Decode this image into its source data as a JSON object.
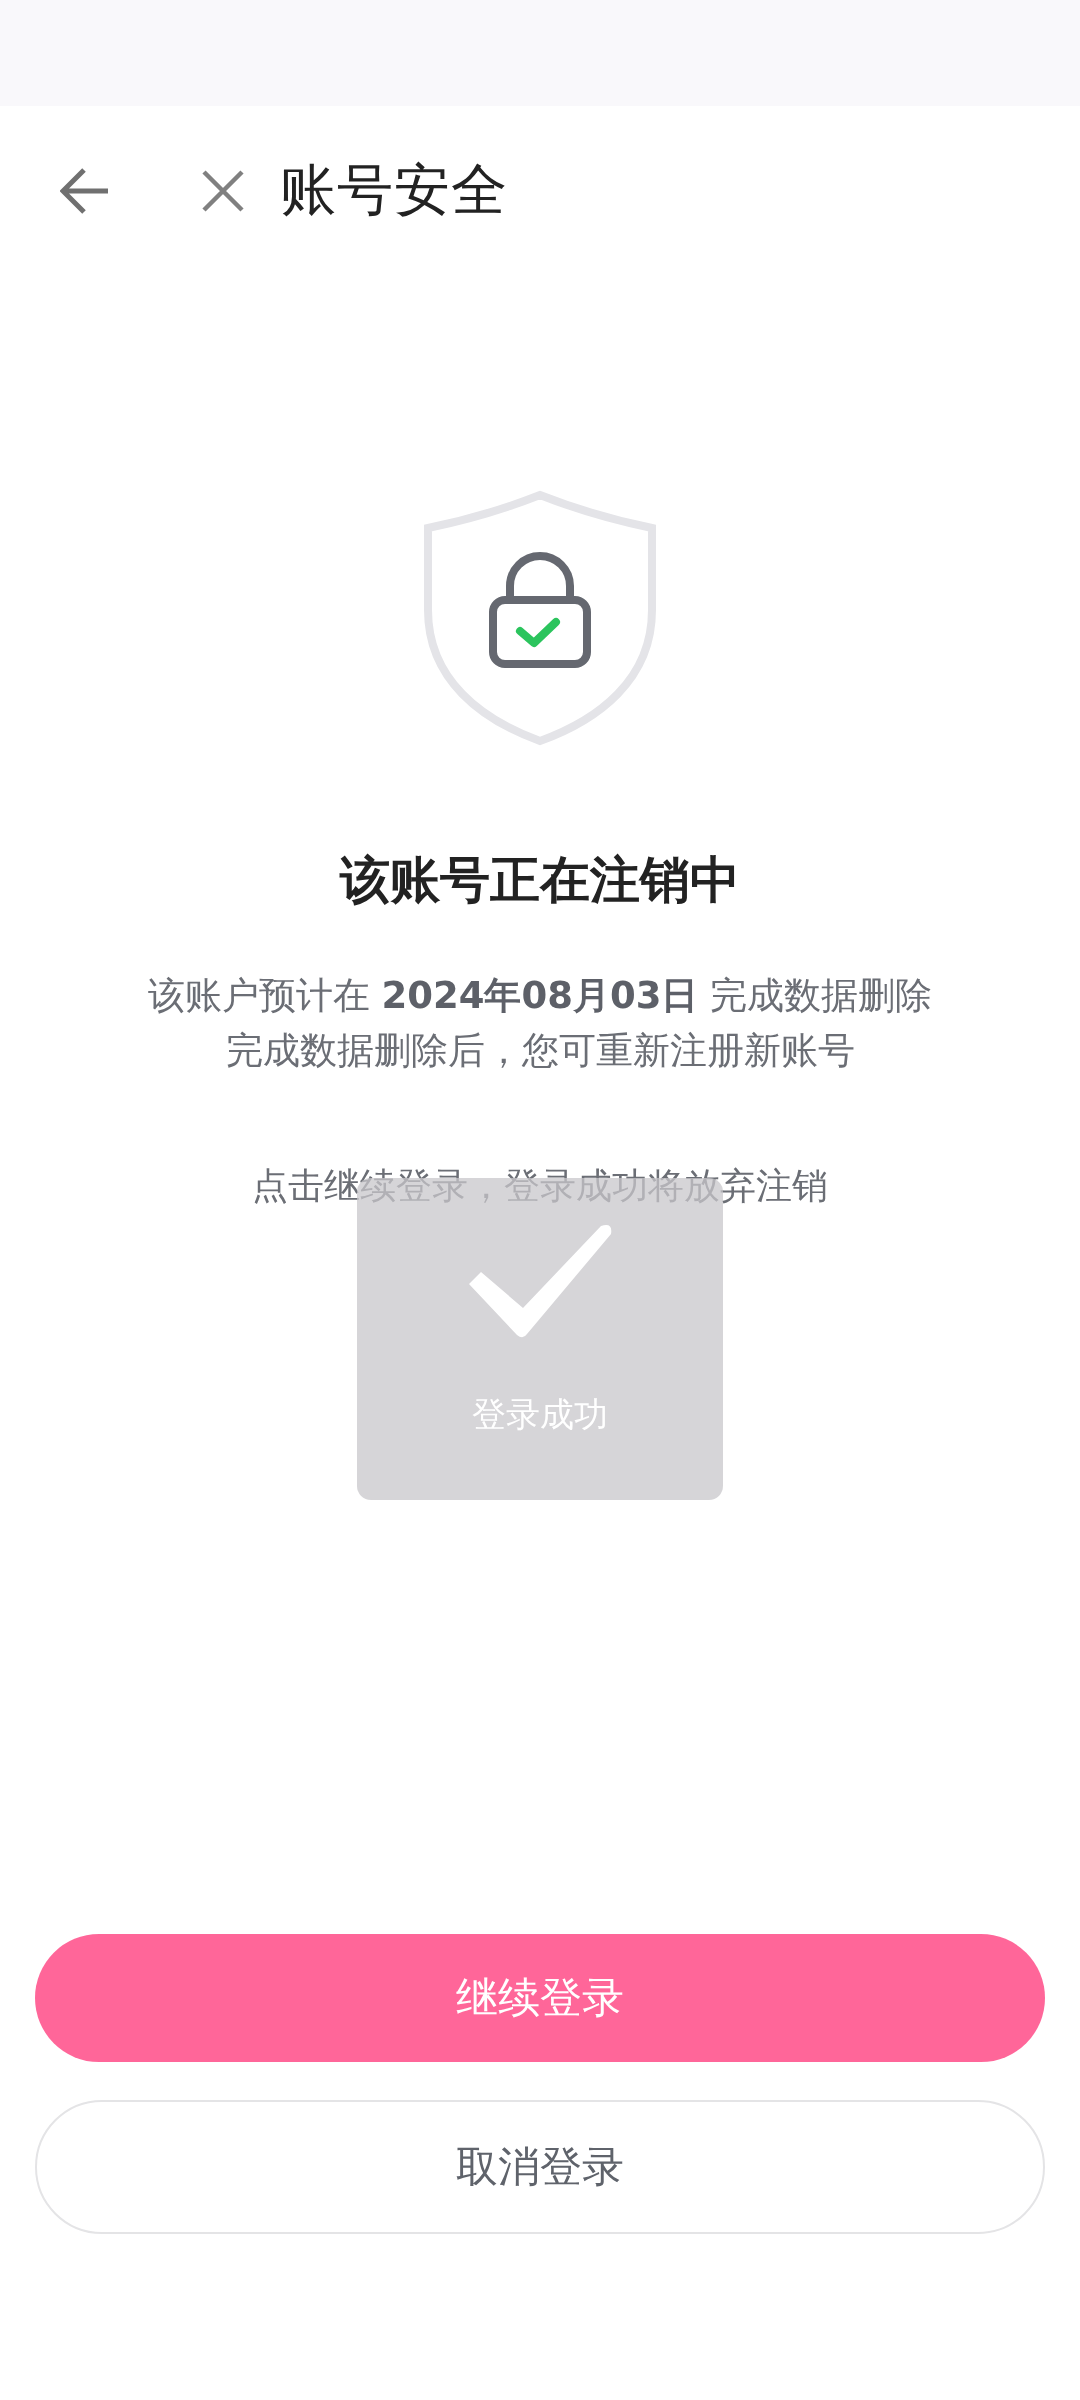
{
  "header": {
    "title": "账号安全"
  },
  "heading": "该账号正在注销中",
  "message_lines": [
    "该账户预计在 **2024年08月03日** 完成数据删除",
    "完成数据删除后，您可重新注册新账号"
  ],
  "hint": "点击继续登录，登录成功将放弃注销",
  "toast": {
    "text": "登录成功"
  },
  "buttons": [
    {
      "label": "继续登录",
      "kind": "primary"
    },
    {
      "label": "取消登录",
      "kind": "secondary"
    }
  ]
}
